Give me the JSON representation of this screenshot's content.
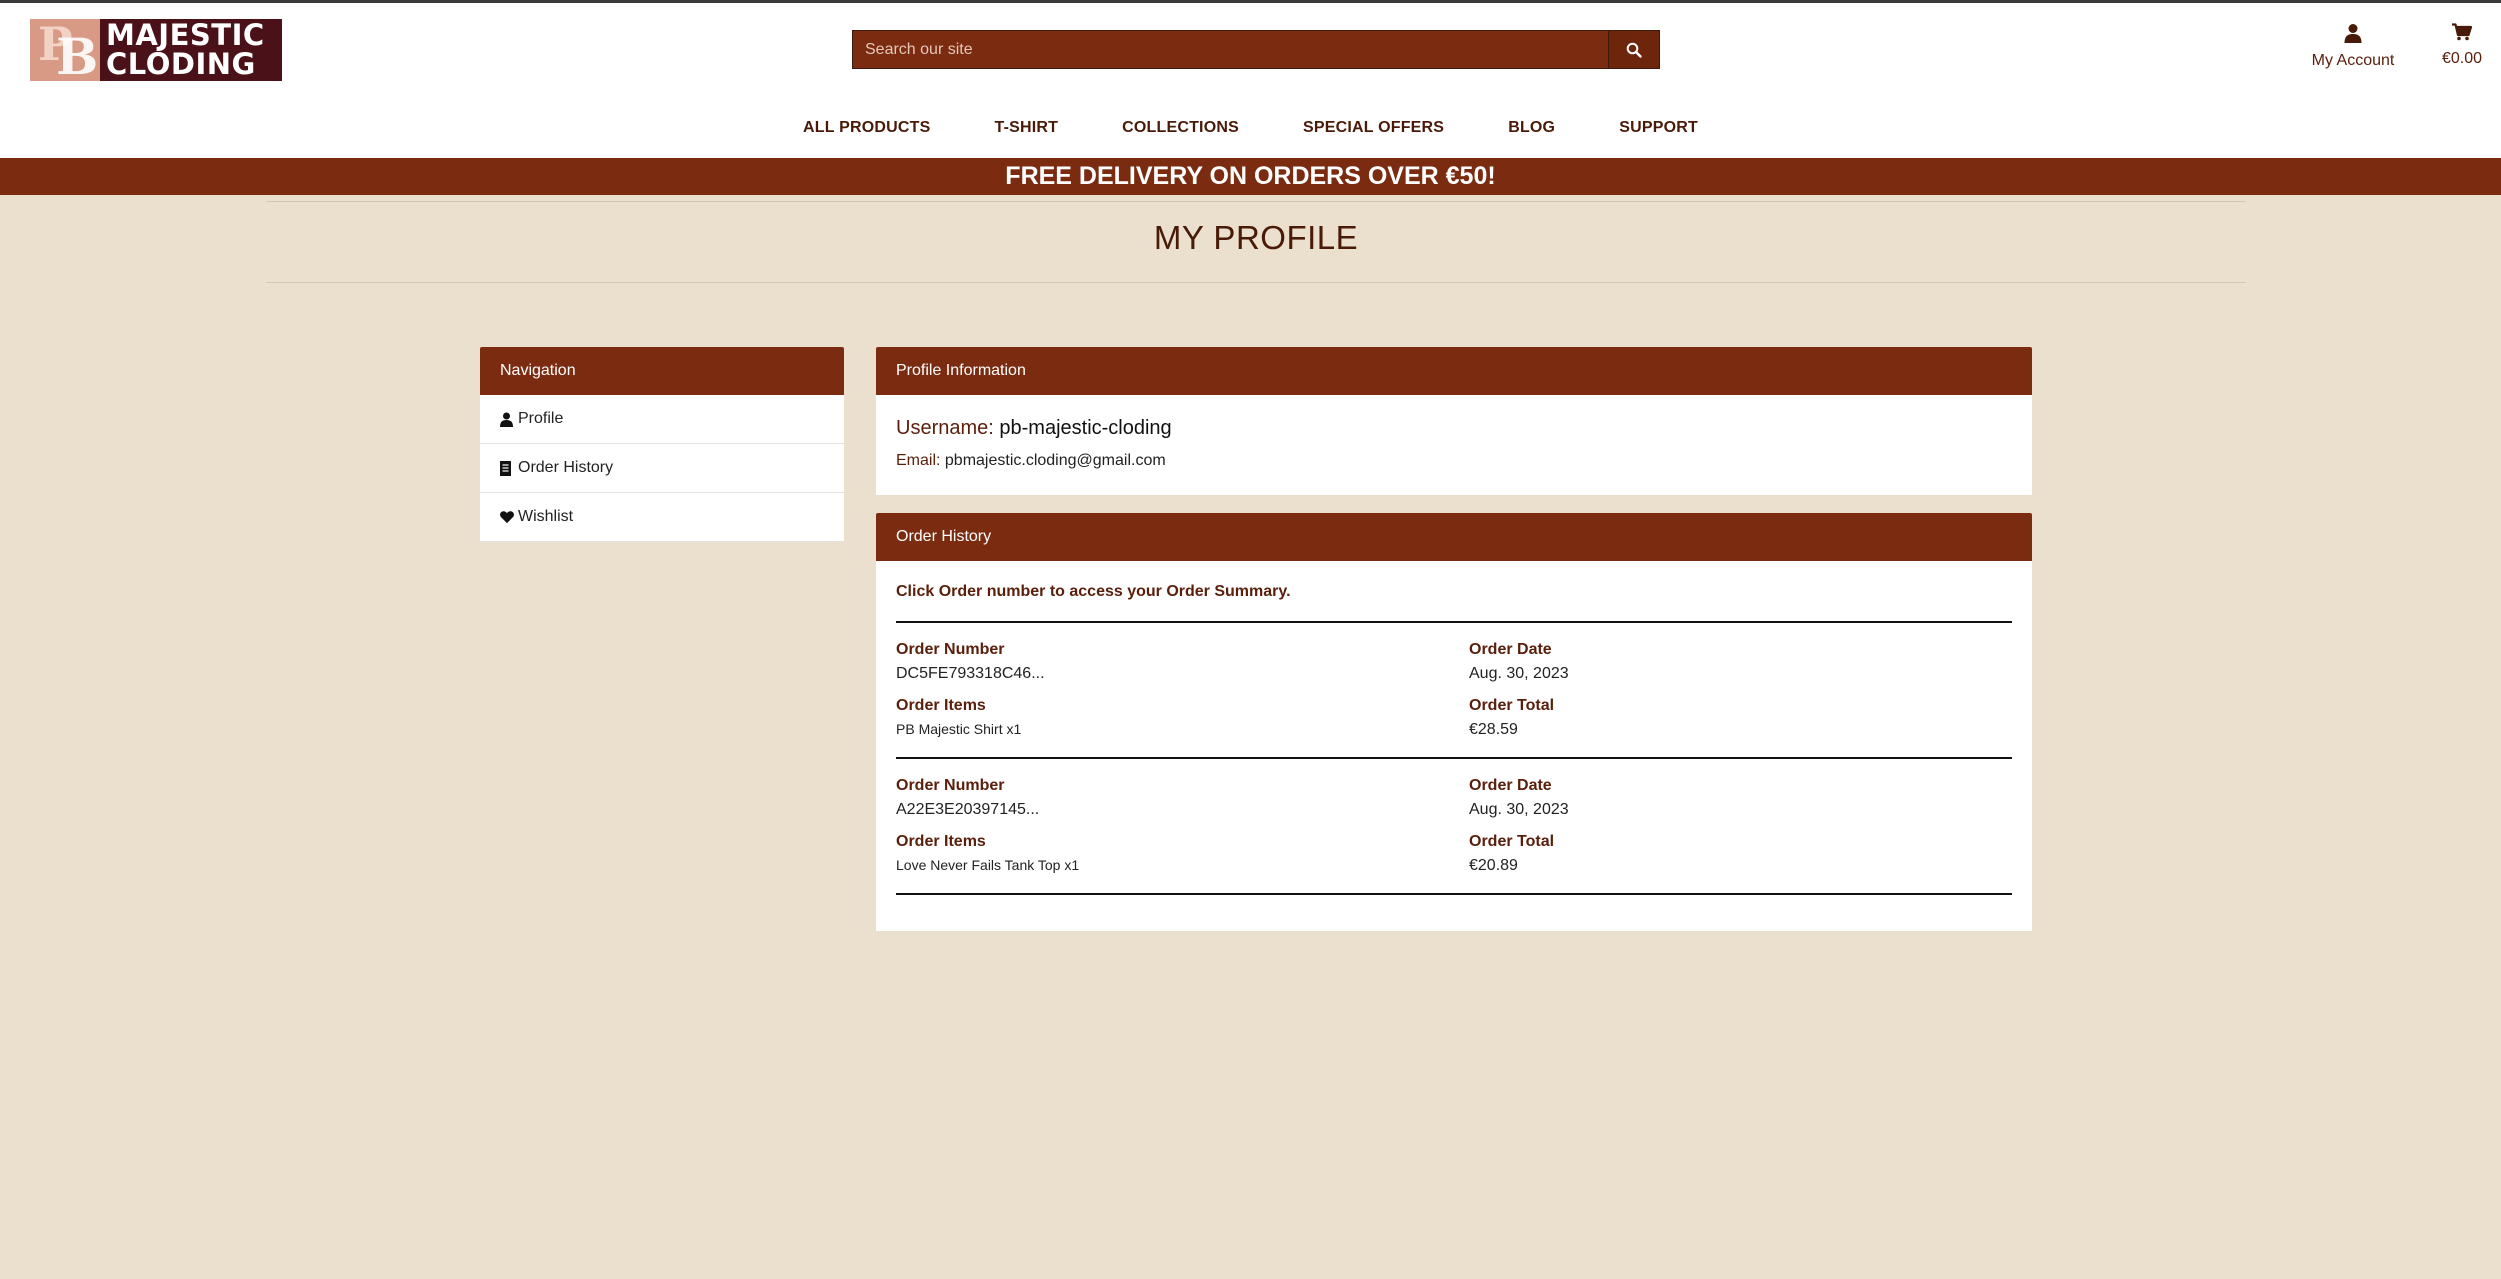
{
  "brand": {
    "logo_line1": "MAJESTIC",
    "logo_line2": "CLODING",
    "logo_mark": "PB",
    "colors": {
      "primary": "#7b2c10",
      "background": "#ebdfcd",
      "logo_bg": "#4a1218"
    }
  },
  "search": {
    "placeholder": "Search our site",
    "icon": "search-icon"
  },
  "account": {
    "label": "My Account",
    "icon": "user-icon"
  },
  "cart": {
    "total": "€0.00",
    "icon": "cart-icon"
  },
  "nav": {
    "items": [
      "ALL PRODUCTS",
      "T-SHIRT",
      "COLLECTIONS",
      "SPECIAL OFFERS",
      "BLOG",
      "SUPPORT"
    ]
  },
  "banner": {
    "text": "FREE DELIVERY ON ORDERS OVER €50!"
  },
  "page": {
    "title": "MY PROFILE"
  },
  "sidebar": {
    "title": "Navigation",
    "items": [
      {
        "label": "Profile",
        "icon": "user-icon"
      },
      {
        "label": "Order History",
        "icon": "receipt-icon"
      },
      {
        "label": "Wishlist",
        "icon": "heart-icon"
      }
    ]
  },
  "profile": {
    "title": "Profile Information",
    "username_label": "Username:",
    "username": "pb-majestic-cloding",
    "email_label": "Email:",
    "email": "pbmajestic.cloding@gmail.com"
  },
  "order_history": {
    "title": "Order History",
    "note": "Click Order number to access your Order Summary.",
    "labels": {
      "number": "Order Number",
      "date": "Order Date",
      "items": "Order Items",
      "total": "Order Total"
    },
    "orders": [
      {
        "number": "DC5FE793318C46...",
        "date": "Aug. 30, 2023",
        "items": "PB Majestic Shirt x1",
        "total": "€28.59"
      },
      {
        "number": "A22E3E20397145...",
        "date": "Aug. 30, 2023",
        "items": "Love Never Fails Tank Top x1",
        "total": "€20.89"
      }
    ]
  }
}
